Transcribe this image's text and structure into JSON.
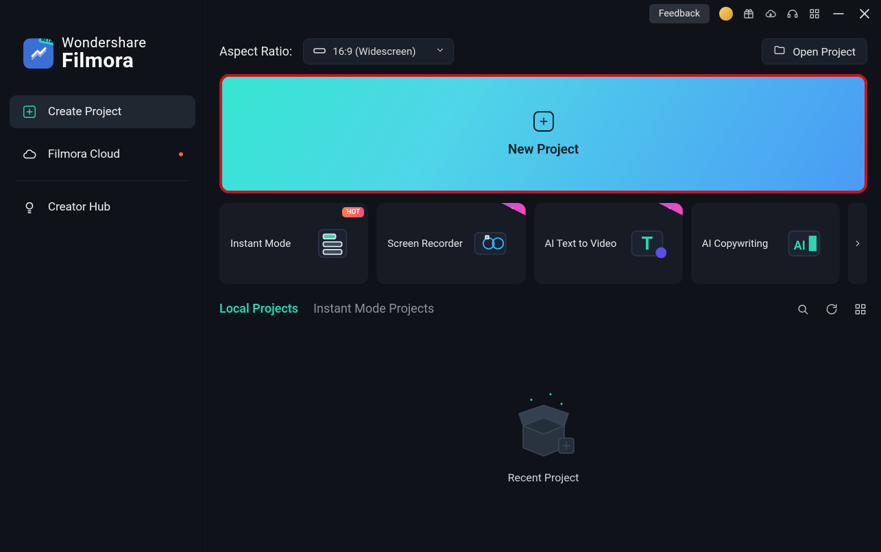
{
  "logo": {
    "brand": "Wondershare",
    "name": "Filmora",
    "badge": "BETA"
  },
  "sidebar": {
    "items": [
      {
        "label": "Create Project",
        "icon": "plus-square-icon",
        "active": true
      },
      {
        "label": "Filmora Cloud",
        "icon": "cloud-icon",
        "hasDot": true
      },
      {
        "label": "Creator Hub",
        "icon": "bulb-icon"
      }
    ]
  },
  "titlebar": {
    "feedback": "Feedback"
  },
  "toolbar": {
    "aspect_label": "Aspect Ratio:",
    "aspect_value": "16:9 (Widescreen)",
    "open_project": "Open Project"
  },
  "new_project": {
    "label": "New Project"
  },
  "features": [
    {
      "label": "Instant Mode",
      "badge": "HOT",
      "badge_kind": "hot"
    },
    {
      "label": "Screen Recorder",
      "badge": "BETA",
      "badge_kind": "beta"
    },
    {
      "label": "AI Text to Video",
      "badge": "BETA",
      "badge_kind": "beta"
    },
    {
      "label": "AI Copywriting",
      "badge": "",
      "badge_kind": ""
    }
  ],
  "tabs": {
    "local": "Local Projects",
    "instant": "Instant Mode Projects"
  },
  "recent": {
    "label": "Recent Project"
  }
}
